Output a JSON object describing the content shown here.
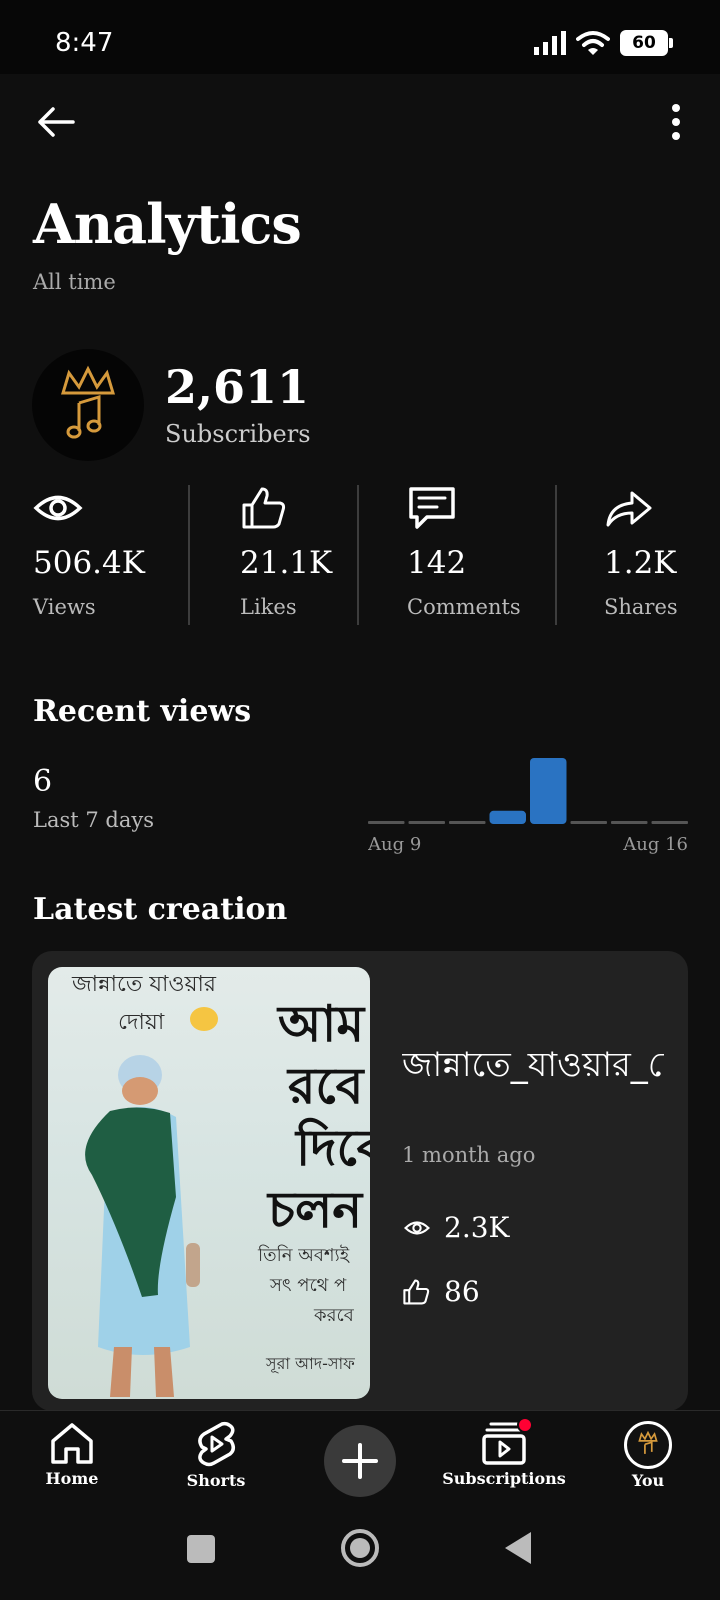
{
  "status_bar": {
    "time": "8:47",
    "battery": "60"
  },
  "header": {
    "title": "Analytics",
    "subtitle": "All time"
  },
  "channel": {
    "subscriber_count": "2,611",
    "subscriber_label": "Subscribers"
  },
  "stats": [
    {
      "icon": "eye-icon",
      "value": "506.4K",
      "label": "Views"
    },
    {
      "icon": "thumbs-up-icon",
      "value": "21.1K",
      "label": "Likes"
    },
    {
      "icon": "comment-icon",
      "value": "142",
      "label": "Comments"
    },
    {
      "icon": "share-icon",
      "value": "1.2K",
      "label": "Shares"
    }
  ],
  "recent_views": {
    "title": "Recent views",
    "count": "6",
    "period": "Last 7 days",
    "x_start_label": "Aug 9",
    "x_end_label": "Aug 16"
  },
  "chart_data": {
    "type": "bar",
    "x": [
      "Aug 9",
      "",
      "",
      "",
      "",
      "",
      "",
      "Aug 16"
    ],
    "values": [
      0,
      0,
      0,
      1,
      5,
      0,
      0,
      0
    ],
    "bar_color": "#2a73c2"
  },
  "latest_creation": {
    "title": "Latest creation",
    "video_title": "জান্নাতে_যাওয়ার_দোয়া_#muslim...",
    "age": "1 month ago",
    "views": "2.3K",
    "likes": "86",
    "thumbnail_text": {
      "line1": "জান্নাতে যাওয়ার",
      "line2": "দোয়া",
      "big1": "আম",
      "big2": "রবে",
      "big3": "দিবে",
      "big4": "চলন",
      "small1": "তিনি অবশ্যই",
      "small2": "সৎ পথে প",
      "small3": "করবে",
      "small4": "সূরা আদ-সাফ"
    }
  },
  "bottom_nav": [
    {
      "label": "Home",
      "icon": "home-icon"
    },
    {
      "label": "Shorts",
      "icon": "shorts-icon"
    },
    {
      "label": "",
      "icon": "plus-icon"
    },
    {
      "label": "Subscriptions",
      "icon": "subscriptions-icon"
    },
    {
      "label": "You",
      "icon": "avatar"
    }
  ],
  "colors": {
    "background": "#0f0f0f",
    "card": "#222222",
    "accent_bar": "#2a73c2",
    "notification_dot": "#ff0033"
  }
}
